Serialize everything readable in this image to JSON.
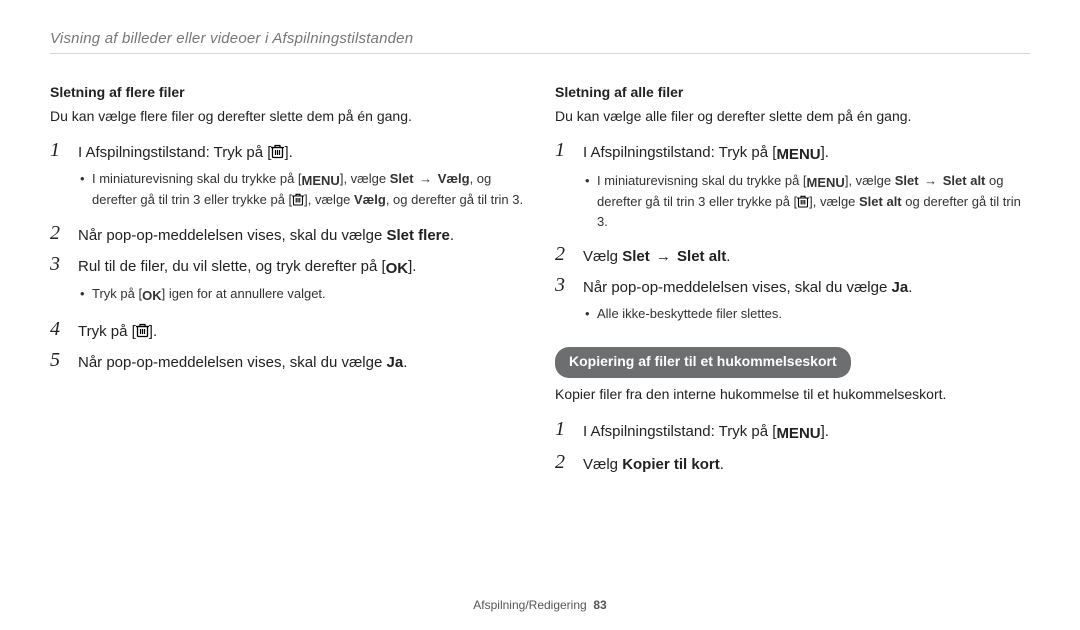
{
  "header": "Visning af billeder eller videoer i Afspilningstilstanden",
  "left": {
    "subhead": "Sletning af flere filer",
    "intro": "Du kan vælge flere filer og derefter slette dem på én gang.",
    "steps": {
      "s1": {
        "num": "1",
        "pre": "I Afspilningstilstand: Tryk på [",
        "post": "].",
        "sub_pre": "I miniaturevisning skal du trykke på [",
        "sub_mid1": "], vælge ",
        "sub_bold1": "Slet",
        "sub_mid2": " → ",
        "sub_bold2": "Vælg",
        "sub_mid3": ", og derefter gå til trin 3 eller trykke på [",
        "sub_mid4": "], vælge ",
        "sub_bold3": "Vælg",
        "sub_mid5": ", og derefter gå til trin 3."
      },
      "s2": {
        "num": "2",
        "text_pre": "Når pop-op-meddelelsen vises, skal du vælge ",
        "bold": "Slet flere",
        "text_post": "."
      },
      "s3": {
        "num": "3",
        "text_pre": "Rul til de filer, du vil slette, og tryk derefter på [",
        "text_post": "].",
        "sub_pre": "Tryk på [",
        "sub_post": "] igen for at annullere valget."
      },
      "s4": {
        "num": "4",
        "text_pre": "Tryk på [",
        "text_post": "]."
      },
      "s5": {
        "num": "5",
        "text_pre": "Når pop-op-meddelelsen vises, skal du vælge ",
        "bold": "Ja",
        "text_post": "."
      }
    }
  },
  "right": {
    "subhead": "Sletning af alle filer",
    "intro": "Du kan vælge alle filer og derefter slette dem på én gang.",
    "steps": {
      "s1": {
        "num": "1",
        "pre": "I Afspilningstilstand: Tryk på [",
        "post": "].",
        "sub_pre": "I miniaturevisning skal du trykke på [",
        "sub_mid1": "], vælge ",
        "sub_bold1": "Slet",
        "sub_mid2": " → ",
        "sub_bold2": "Slet alt",
        "sub_mid3": " og derefter gå til trin 3 eller trykke på [",
        "sub_mid4": "], vælge ",
        "sub_bold3": "Slet alt",
        "sub_mid5": " og derefter gå til trin 3."
      },
      "s2": {
        "num": "2",
        "text_pre": "Vælg ",
        "bold1": "Slet",
        "mid": " → ",
        "bold2": "Slet alt",
        "text_post": "."
      },
      "s3": {
        "num": "3",
        "text_pre": "Når pop-op-meddelelsen vises, skal du vælge ",
        "bold": "Ja",
        "text_post": ".",
        "sub": "Alle ikke-beskyttede filer slettes."
      }
    },
    "pill": "Kopiering af filer til et hukommelseskort",
    "pill_intro": "Kopier filer fra den interne hukommelse til et hukommelseskort.",
    "steps2": {
      "s1": {
        "num": "1",
        "pre": "I Afspilningstilstand: Tryk på [",
        "post": "]."
      },
      "s2": {
        "num": "2",
        "text_pre": "Vælg ",
        "bold": "Kopier til kort",
        "text_post": "."
      }
    }
  },
  "footer": {
    "section": "Afspilning/Redigering",
    "page": "83"
  },
  "icons": {
    "trash": "trash-icon",
    "menu": "MENU",
    "ok": "OK"
  }
}
